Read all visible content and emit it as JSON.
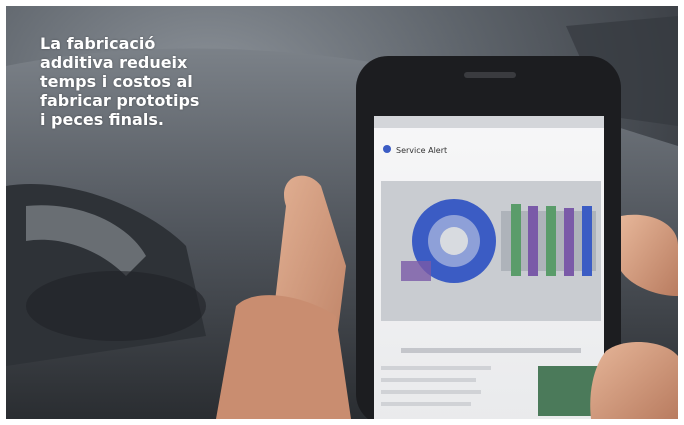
{
  "caption": {
    "headline": "La fabricació\nadditiva redueix\ntemps i costos al\nfabricar prototips\ni peces finals."
  },
  "phone": {
    "app_header": "Service Alert"
  },
  "colors": {
    "accent_blue": "#3b5cc4",
    "car_body": "#4a4f56",
    "skin": "#d9a385"
  }
}
